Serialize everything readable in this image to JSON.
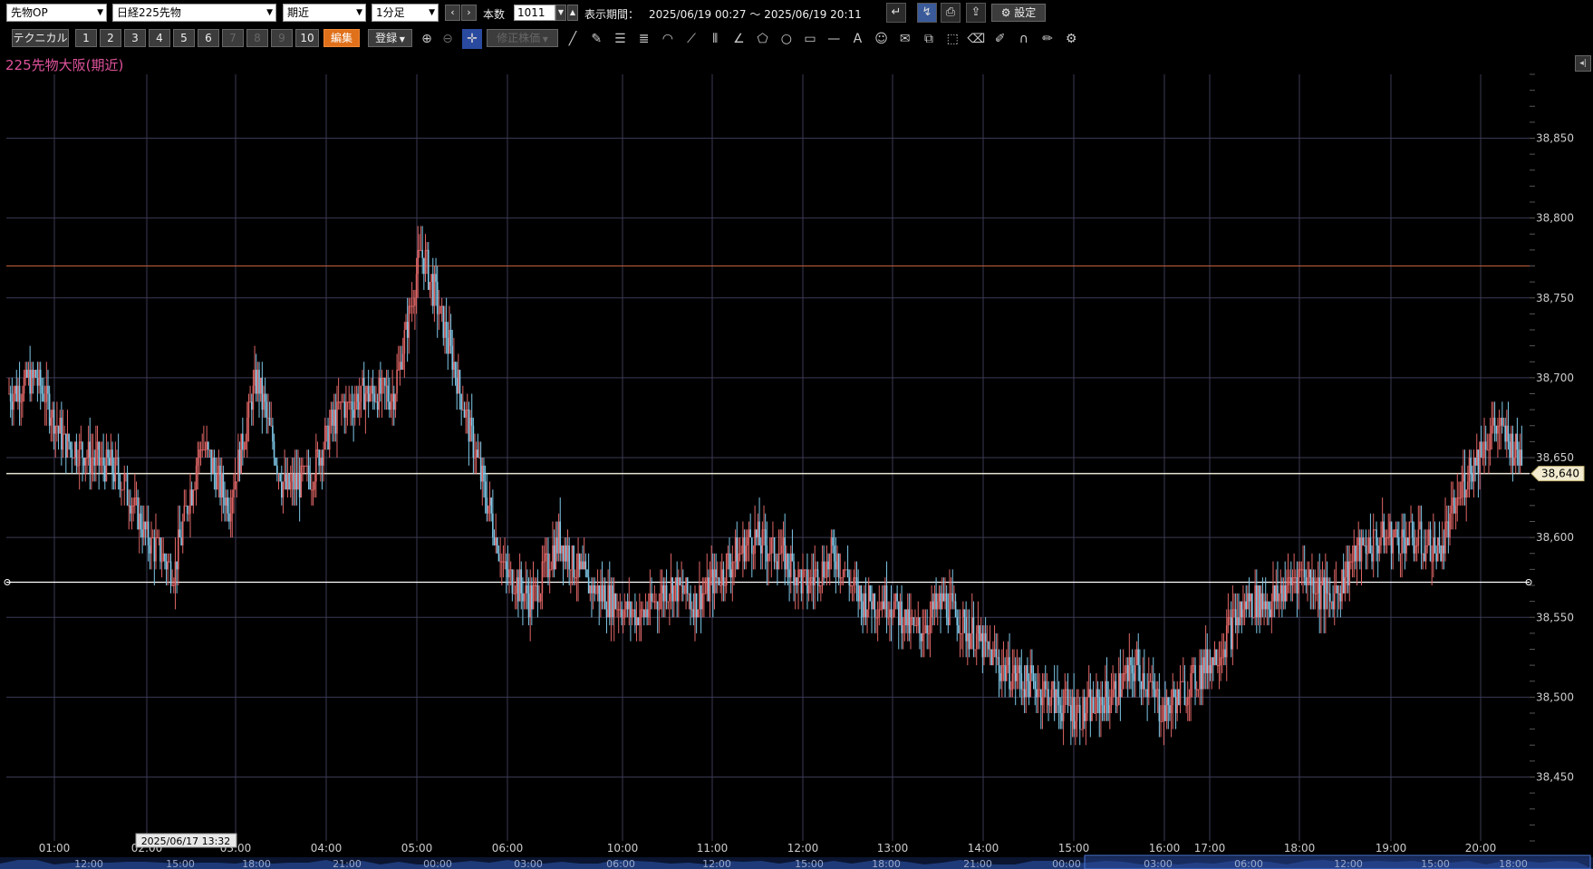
{
  "toolbar1": {
    "category_select": "先物OP",
    "instrument_select": "日経225先物",
    "contract_select": "期近",
    "interval_select": "1分足",
    "prev_icon": "chevron-left-icon",
    "next_icon": "chevron-right-icon",
    "bars_label": "本数",
    "bars_value": "1011",
    "period_label": "表示期間：",
    "period_value": "2025/06/19 00:27 ～ 2025/06/19 20:11",
    "settings_label": "設定"
  },
  "toolbar2": {
    "technical_label": "テクニカル",
    "slots": [
      "1",
      "2",
      "3",
      "4",
      "5",
      "6",
      "7",
      "8",
      "9",
      "10"
    ],
    "edit_label": "編集",
    "register_label": "登録",
    "adjusted_label": "修正株価"
  },
  "chart": {
    "title": "225先物大阪(期近)",
    "current_price_label": "38,640",
    "top_time_labels": [
      "01:00",
      "02:00",
      "03:00",
      "04:00",
      "05:00",
      "06:00",
      "10:00",
      "11:00",
      "12:00",
      "13:00",
      "14:00",
      "15:00",
      "16:00",
      "17:00",
      "18:00",
      "19:00",
      "20:00"
    ],
    "cursor_label": "2025/06/17 13:32",
    "nav_time_labels": [
      "12:00",
      "15:00",
      "18:00",
      "21:00",
      "00:00",
      "03:00",
      "06:00",
      "12:00",
      "15:00",
      "18:00",
      "21:00",
      "00:00",
      "03:00",
      "06:00",
      "12:00",
      "15:00",
      "18:00"
    ],
    "colors": {
      "up": "#e06666",
      "down": "#7ec8e8",
      "grid": "#3a3a55",
      "resistance": "#c0603a"
    }
  },
  "chart_data": {
    "type": "candlestick",
    "title": "225先物大阪(期近)",
    "y_ticks": [
      "38,450",
      "38,500",
      "38,550",
      "38,600",
      "38,650",
      "38,700",
      "38,750",
      "38,800",
      "38,850"
    ],
    "ylim": [
      38410,
      38890
    ],
    "x": [
      "01:00",
      "02:00",
      "03:00",
      "04:00",
      "05:00",
      "06:00",
      "10:00",
      "11:00",
      "12:00",
      "13:00",
      "14:00",
      "15:00",
      "16:00",
      "17:00",
      "18:00",
      "19:00",
      "20:00"
    ],
    "close_series": [
      38690,
      38700,
      38660,
      38650,
      38640,
      38600,
      38580,
      38660,
      38620,
      38700,
      38630,
      38640,
      38680,
      38690,
      38690,
      38780,
      38720,
      38650,
      38580,
      38560,
      38600,
      38570,
      38560,
      38550,
      38570,
      38560,
      38580,
      38600,
      38590,
      38570,
      38590,
      38560,
      38560,
      38540,
      38560,
      38540,
      38520,
      38510,
      38500,
      38490,
      38500,
      38520,
      38490,
      38510,
      38530,
      38560,
      38560,
      38580,
      38560,
      38590,
      38600,
      38600,
      38590,
      38640,
      38670,
      38650
    ],
    "horizontal_lines": [
      38770,
      38640,
      38572
    ],
    "current_price": 38640,
    "grid": true
  }
}
